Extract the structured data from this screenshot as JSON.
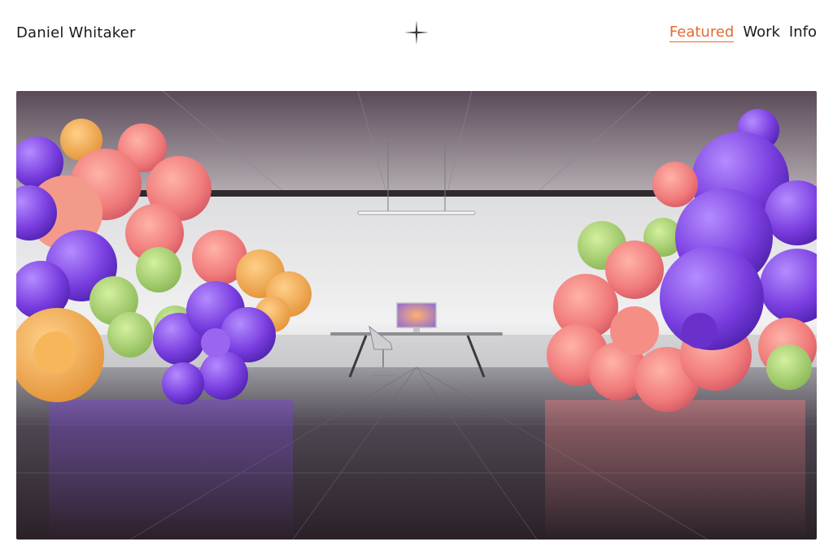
{
  "site": {
    "brand_name": "Daniel Whitaker",
    "logo_icon": "four-point-star-icon"
  },
  "nav": {
    "items": [
      {
        "label": "Featured",
        "active": true
      },
      {
        "label": "Work",
        "active": false
      },
      {
        "label": "Info",
        "active": false
      }
    ],
    "accent_color": "#e8692d"
  },
  "hero": {
    "image_subject": "office-interior-with-3d-flower-sculptures",
    "palette": [
      "#7a3ee0",
      "#f07a7a",
      "#9fcf6a",
      "#f0a040",
      "#cfcfd3"
    ]
  }
}
